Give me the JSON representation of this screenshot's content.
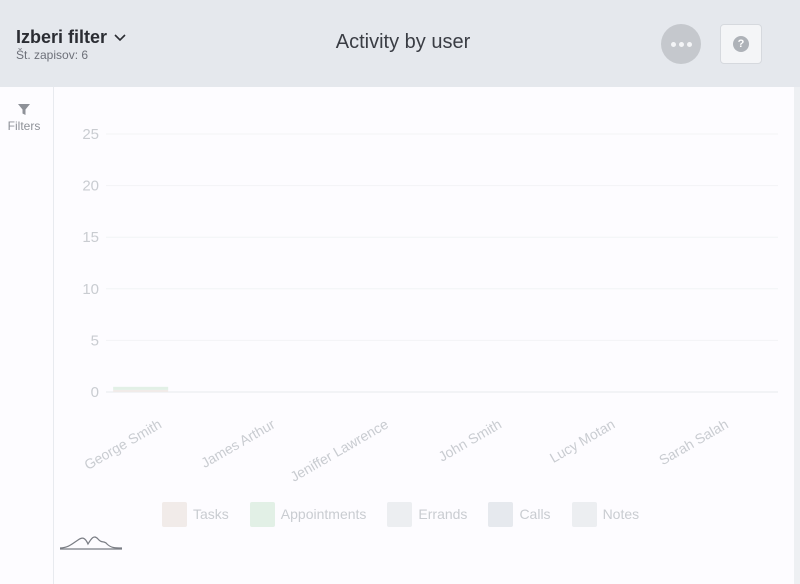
{
  "header": {
    "filter_title": "Izberi filter",
    "record_count": "Št. zapisov: 6",
    "page_title": "Activity by user"
  },
  "sidebar": {
    "filters_label": "Filters"
  },
  "colors": {
    "tasks": "#f1ebe9",
    "appointments": "#e2f0e6",
    "errands": "#eceef1",
    "calls": "#e6e9ee",
    "notes": "#eceef1"
  },
  "chart_data": {
    "type": "bar",
    "stacked": true,
    "categories": [
      "George Smith",
      "James Arthur",
      "Jeniffer Lawrence",
      "John Smith",
      "Lucy Motan",
      "Sarah Salah"
    ],
    "series": [
      {
        "name": "Tasks",
        "values": [
          0.2,
          0,
          0,
          0,
          0,
          0
        ]
      },
      {
        "name": "Appointments",
        "values": [
          0.3,
          0,
          0,
          0,
          0,
          0
        ]
      },
      {
        "name": "Errands",
        "values": [
          0,
          0,
          0,
          0,
          0,
          0
        ]
      },
      {
        "name": "Calls",
        "values": [
          0,
          0,
          0,
          0,
          0,
          0
        ]
      },
      {
        "name": "Notes",
        "values": [
          0,
          0,
          0,
          0,
          0,
          0
        ]
      }
    ],
    "yticks": [
      0,
      5,
      10,
      15,
      20,
      25
    ],
    "ylim": [
      0,
      25
    ],
    "grid": true,
    "legend": "bottom"
  }
}
